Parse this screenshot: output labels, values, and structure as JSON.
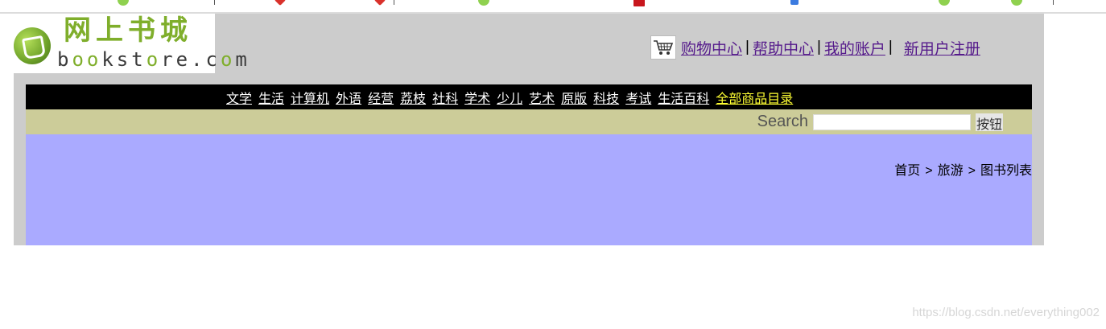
{
  "logo": {
    "cn": "网上书城",
    "en_parts": [
      "b",
      "oo",
      "kst",
      "o",
      "re.c",
      "o",
      "m"
    ]
  },
  "user_nav": {
    "cart_label": "购物中心",
    "help_label": "帮助中心",
    "account_label": "我的账户",
    "register_label": "新用户注册",
    "separator": "|"
  },
  "categories": [
    "文学",
    "生活",
    "计算机",
    "外语",
    "经营",
    "荔枝",
    "社科",
    "学术",
    "少儿",
    "艺术",
    "原版",
    "科技",
    "考试",
    "生活百科"
  ],
  "all_products_label": "全部商品目录",
  "search": {
    "label": "Search",
    "value": "",
    "button_label": "按钮"
  },
  "breadcrumb": {
    "items": [
      "首页",
      "旅游",
      "图书列表"
    ],
    "separator": ">"
  },
  "watermark": "https://blog.csdn.net/everything002",
  "colors": {
    "shell": "#cccccc",
    "category_bar": "#000000",
    "search_bar": "#cccc99",
    "content": "#aaaaff",
    "all_products": "#ffff33",
    "link": "#551a8b"
  }
}
